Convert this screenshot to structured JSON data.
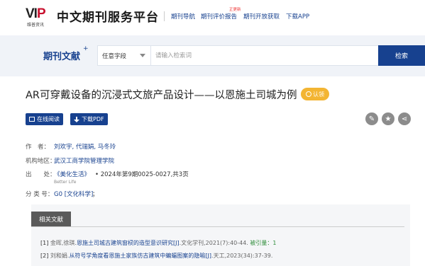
{
  "header": {
    "logo_text": "VIP",
    "logo_sub": "维普资讯",
    "site_title": "中文期刊服务平台",
    "nav": [
      "期刊导航",
      "期刊评价报告",
      "期刊开放获取",
      "下载APP"
    ],
    "new_badge": "正更新"
  },
  "search": {
    "module_title": "期刊文献",
    "plus": "+",
    "field_label": "任意字段",
    "placeholder": "请输入检索词",
    "button_label": "检索"
  },
  "article": {
    "title": "AR可穿戴设备的沉浸式文旅产品设计——以恩施土司城为例",
    "claim_label": "认领",
    "read_online": "在线阅读",
    "download_pdf": "下载PDF",
    "icons": [
      "share-alt-icon",
      "star-icon",
      "share-icon"
    ],
    "authors_label": "作　者：",
    "authors": "刘欢宇, 代瑞娟, 马冬玲",
    "org_label": "机构地区：",
    "org": "武汉工商学院管理学院",
    "source_label": "出　　处：",
    "journal": "《美化生活》",
    "issue": "• 2024年第9期0025-0027,共3页",
    "journal_en": "Better Life",
    "class_label": "分 类 号：",
    "class_code": "G0 [文化科学]",
    "class_tail": "；"
  },
  "related": {
    "tab_label": "相关文献",
    "refs": [
      {
        "num": "[1]",
        "author": "金晖,徐琪.",
        "title": "恩施土司城古建筑窗棂的造型意识研究[J]",
        "source": ".文化学刊,2021(7):40-44.",
        "cited": "被引量：1"
      },
      {
        "num": "[2]",
        "author": "刘和娟.",
        "title": "从符号学角度看恩施土家族仿古建筑中蝙蝠图案的隐喻[J]",
        "source": ".天工,2023(34):37-39.",
        "cited": ""
      }
    ]
  },
  "colors": {
    "brand_blue": "#17418f",
    "claim_gold": "#f3b533",
    "logo_red": "#c8102e"
  }
}
